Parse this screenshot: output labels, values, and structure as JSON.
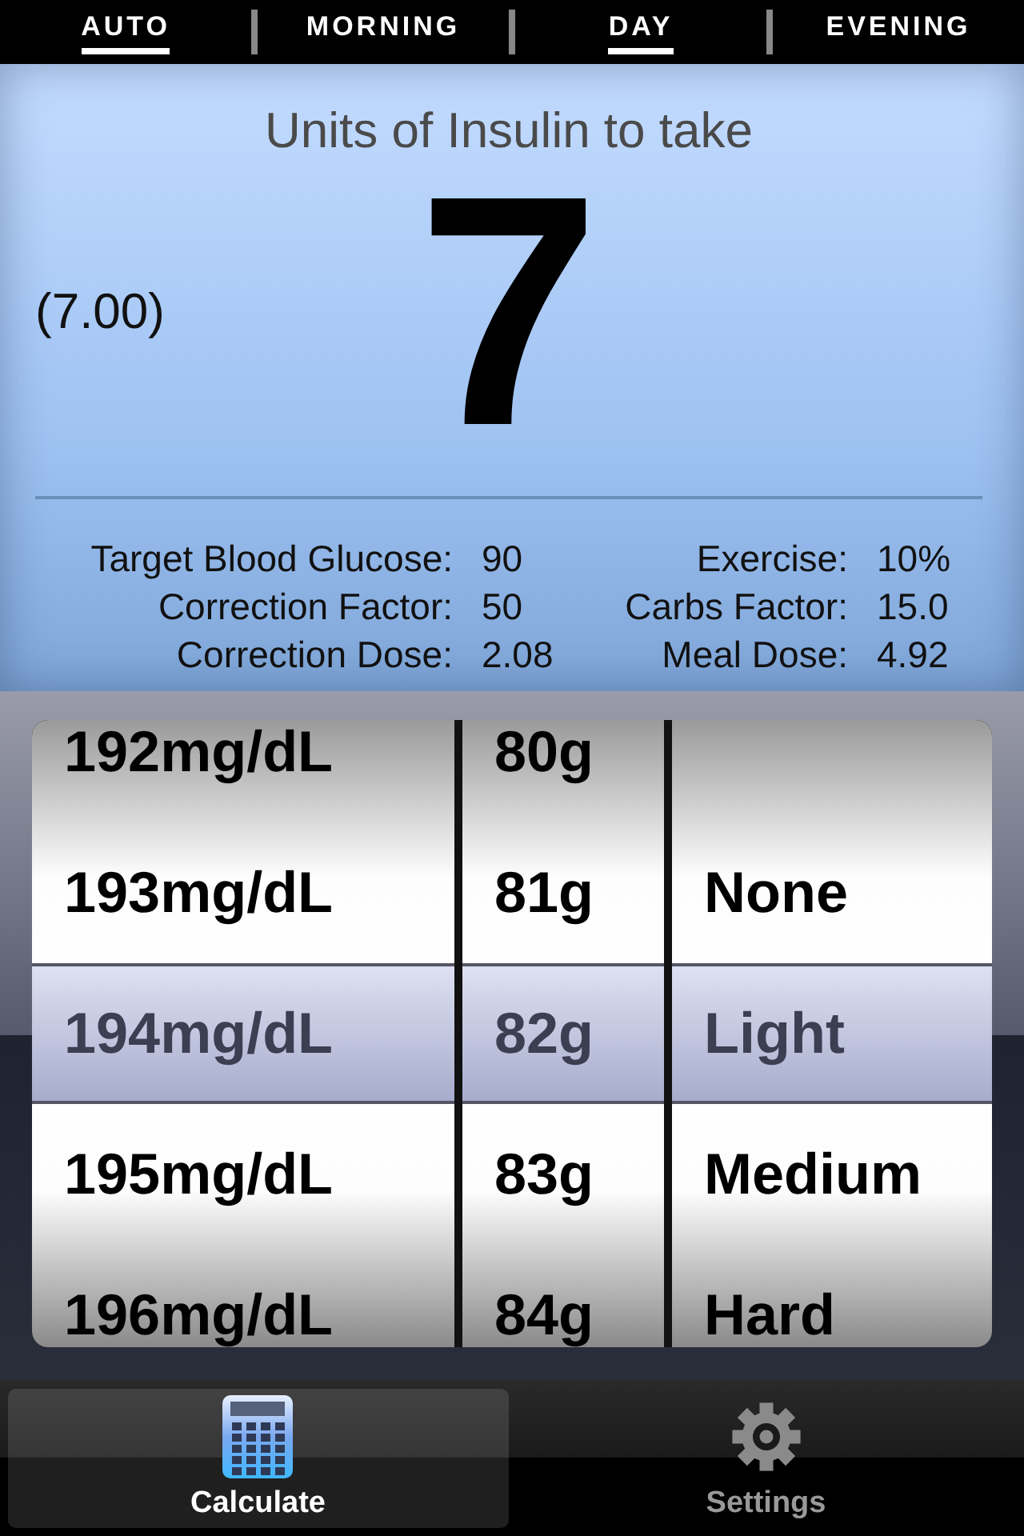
{
  "time_tabs": [
    {
      "label": "AUTO",
      "selected": true
    },
    {
      "label": "MORNING",
      "selected": false
    },
    {
      "label": "DAY",
      "selected": true
    },
    {
      "label": "EVENING",
      "selected": false
    }
  ],
  "result": {
    "title": "Units of Insulin to take",
    "exact": "(7.00)",
    "units": "7"
  },
  "stats": [
    {
      "label": "Target Blood Glucose:",
      "value": "90"
    },
    {
      "label": "Exercise:",
      "value": "10%"
    },
    {
      "label": "Correction Factor:",
      "value": "50"
    },
    {
      "label": "Carbs Factor:",
      "value": "15.0"
    },
    {
      "label": "Correction Dose:",
      "value": "2.08"
    },
    {
      "label": "Meal Dose:",
      "value": "4.92"
    }
  ],
  "picker": {
    "columns": [
      {
        "items": [
          {
            "label": "192mg/dL",
            "selected": false
          },
          {
            "label": "193mg/dL",
            "selected": false
          },
          {
            "label": "194mg/dL",
            "selected": true
          },
          {
            "label": "195mg/dL",
            "selected": false
          },
          {
            "label": "196mg/dL",
            "selected": false
          }
        ]
      },
      {
        "items": [
          {
            "label": "80g",
            "selected": false
          },
          {
            "label": "81g",
            "selected": false
          },
          {
            "label": "82g",
            "selected": true
          },
          {
            "label": "83g",
            "selected": false
          },
          {
            "label": "84g",
            "selected": false
          }
        ]
      },
      {
        "items": [
          {
            "label": "None",
            "selected": false
          },
          {
            "label": "Light",
            "selected": true
          },
          {
            "label": "Medium",
            "selected": false
          },
          {
            "label": "Hard",
            "selected": false
          }
        ]
      }
    ]
  },
  "tab_bar": [
    {
      "label": "Calculate",
      "kind": "calculator",
      "selected": true
    },
    {
      "label": "Settings",
      "kind": "gear",
      "selected": false
    }
  ]
}
